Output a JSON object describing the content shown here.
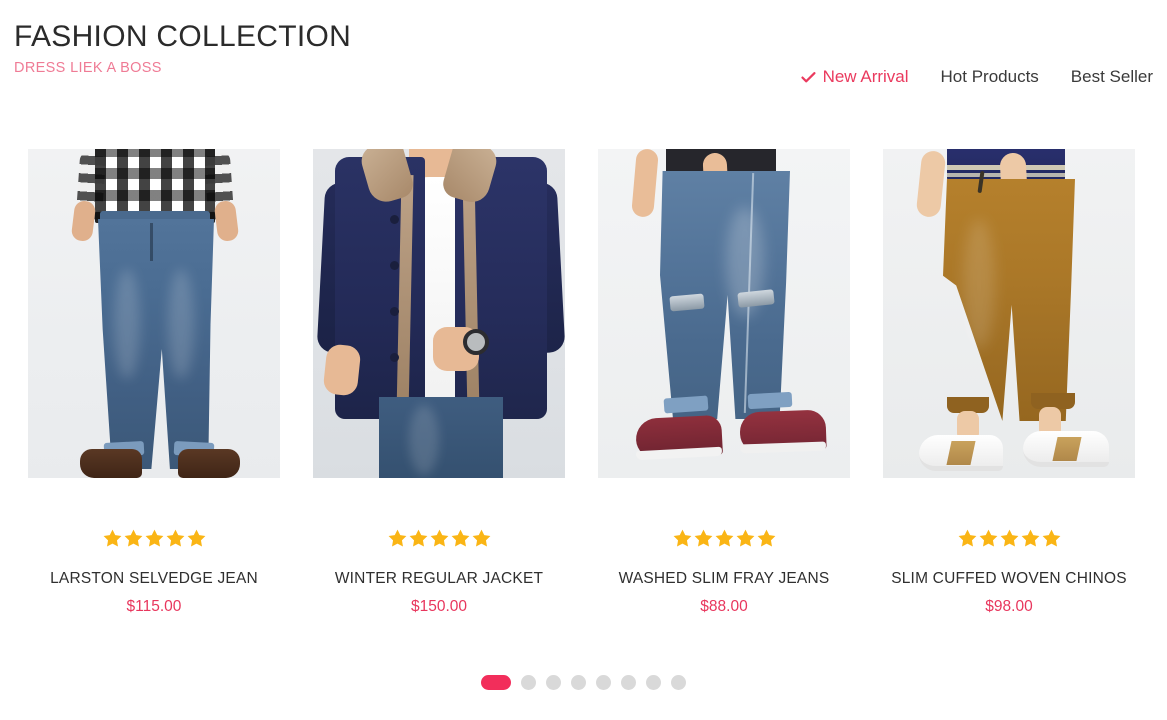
{
  "header": {
    "title": "FASHION COLLECTION",
    "subtitle": "DRESS LIEK A BOSS",
    "nav": [
      {
        "label": "New Arrival",
        "active": true,
        "icon": "check-icon"
      },
      {
        "label": "Hot Products",
        "active": false
      },
      {
        "label": "Best Seller",
        "active": false
      }
    ]
  },
  "products": [
    {
      "name": "LARSTON SELVEDGE JEAN",
      "price": "$115.00",
      "rating": 5,
      "image_alt": "man in black and white plaid shirt wearing blue selvedge jeans and brown leather boots"
    },
    {
      "name": "WINTER REGULAR JACKET",
      "price": "$150.00",
      "rating": 5,
      "image_alt": "man in navy blue winter jacket with tan fur collar over white t-shirt and blue jeans, wearing a watch"
    },
    {
      "name": "WASHED SLIM FRAY JEANS",
      "price": "$88.00",
      "rating": 5,
      "image_alt": "man in dark t-shirt wearing washed slim ripped blue jeans with maroon sneakers"
    },
    {
      "name": "SLIM CUFFED WOVEN CHINOS",
      "price": "$98.00",
      "rating": 5,
      "image_alt": "man in navy striped shirt wearing tan cuffed chinos with white slip-on sneakers"
    }
  ],
  "carousel": {
    "total_dots": 8,
    "active_index": 0
  },
  "colors": {
    "accent_pink": "#e8365d",
    "accent_dot": "#f22e5b",
    "subtitle_pink": "#ef7b95",
    "star_gold": "#fab515",
    "text_dark": "#2f2f2f",
    "dot_inactive": "#d9d9d9"
  }
}
